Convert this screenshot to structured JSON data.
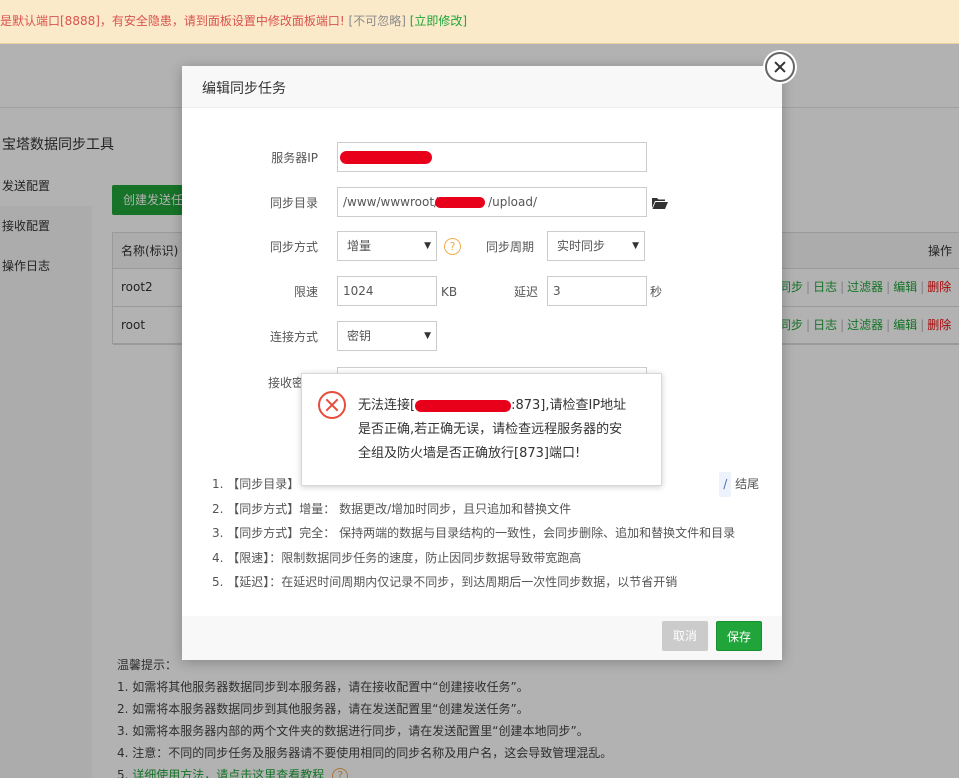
{
  "warning": {
    "text": "是默认端口[8888]，有安全隐患，请到面板设置中修改面板端口!",
    "ignore": "[不可忽略]",
    "fix": "[立即修改]"
  },
  "plugin": {
    "title": "宝塔数据同步工具",
    "menu": [
      "发送配置",
      "接收配置",
      "操作日志"
    ],
    "create_button": "创建发送任务",
    "table": {
      "col_name": "名称(标识)",
      "col_ops": "操作",
      "rows": [
        {
          "name": "root2"
        },
        {
          "name": "root"
        }
      ],
      "ops": {
        "sync": "同步",
        "log": "日志",
        "filter": "过滤器",
        "edit": "编辑",
        "delete": "删除"
      }
    },
    "tips": {
      "heading": "温馨提示：",
      "items": [
        "1. 如需将其他服务器数据同步到本服务器，请在接收配置中“创建接收任务”。",
        "2. 如需将本服务器数据同步到其他服务器，请在发送配置里“创建发送任务”。",
        "3. 如需将本服务器内部的两个文件夹的数据进行同步，请在发送配置里“创建本地同步”。",
        "4. 注意：不同的同步任务及服务器请不要使用相同的同步名称及用户名，这会导致管理混乱。"
      ],
      "last_prefix": "5.",
      "last_link": "详细使用方法，请点击这里查看教程",
      "help": "?"
    }
  },
  "modal": {
    "title": "编辑同步任务",
    "form": {
      "server_ip_label": "服务器IP",
      "server_ip_value": "",
      "sync_dir_label": "同步目录",
      "sync_dir_prefix": "/www/wwwroot/",
      "sync_dir_suffix": "/upload/",
      "method_label": "同步方式",
      "method_value": "增量",
      "help": "?",
      "period_label": "同步周期",
      "period_value": "实时同步",
      "speed_label": "限速",
      "speed_value": "1024",
      "speed_unit": "KB",
      "delay_label": "延迟",
      "delay_value": "3",
      "delay_unit": "秒",
      "conn_label": "连接方式",
      "conn_value": "密钥",
      "recv_label": "接收密"
    },
    "notes": [
      "1. 【同步目录】",
      "2. 【同步方式】增量： 数据更改/增加时同步，且只追加和替换文件",
      "3. 【同步方式】完全： 保持两端的数据与目录结构的一致性，会同步删除、追加和替换文件和目录",
      "4. 【限速】：限制数据同步任务的速度，防止因同步数据导致带宽跑高",
      "5. 【延迟】：在延迟时间周期内仅记录不同步，到达周期后一次性同步数据，以节省开销"
    ],
    "note1_tail": "结尾",
    "note1_slash": "/",
    "cancel": "取消",
    "save": "保存"
  },
  "error": {
    "line1_prefix": "无法连接[",
    "line1_suffix": ":873],请检查IP地址",
    "line2": "是否正确,若正确无误，请检查远程服务器的安",
    "line3": "全组及防火墙是否正确放行[873]端口!"
  }
}
